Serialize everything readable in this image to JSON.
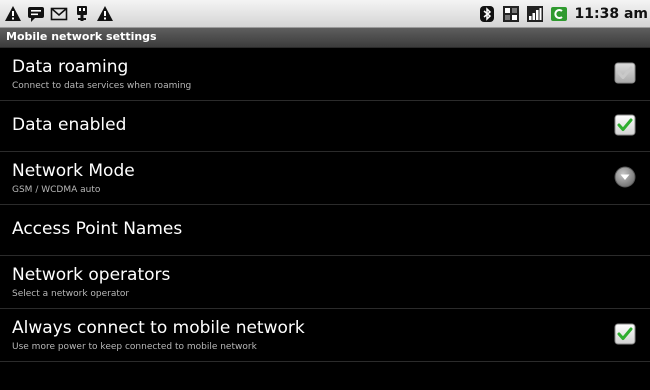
{
  "status_bar": {
    "left_icons": [
      "warning-icon",
      "chat-icon",
      "mail-icon",
      "usb-icon",
      "warning-icon"
    ],
    "right_icons": [
      "bluetooth-icon",
      "data-sync-icon",
      "signal-icon",
      "battery-icon"
    ],
    "time": "11:38 am"
  },
  "title_bar": {
    "title": "Mobile network settings"
  },
  "settings": [
    {
      "title": "Data roaming",
      "summary": "Connect to data services when roaming",
      "control": "checkbox",
      "checked": true,
      "enabled": false
    },
    {
      "title": "Data enabled",
      "summary": "",
      "control": "checkbox",
      "checked": true,
      "enabled": true
    },
    {
      "title": "Network Mode",
      "summary": "GSM / WCDMA auto",
      "control": "dropdown",
      "enabled": true
    },
    {
      "title": "Access Point Names",
      "summary": "",
      "control": "none"
    },
    {
      "title": "Network operators",
      "summary": "Select a network operator",
      "control": "none"
    },
    {
      "title": "Always connect to mobile network",
      "summary": "Use more power to keep connected to mobile network",
      "control": "checkbox",
      "checked": true,
      "enabled": true
    }
  ],
  "colors": {
    "check_green": "#2fae2f",
    "checkbox_disabled": "#bdbdbd",
    "background": "#000000"
  }
}
